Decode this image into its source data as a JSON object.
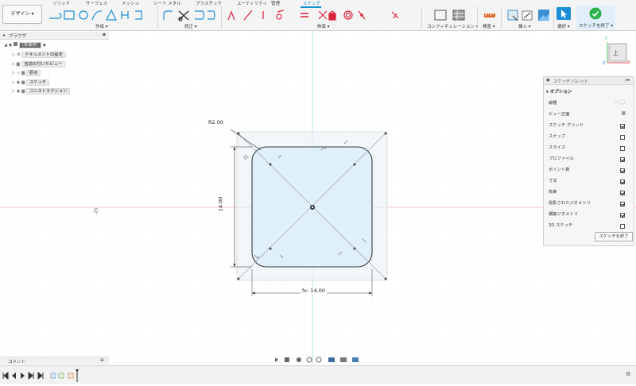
{
  "toolbar": {
    "workspace": "デザイン",
    "tabs": [
      "ソリッド",
      "サーフェス",
      "メッシュ",
      "シート メタル",
      "プラスチック",
      "ユーティリティ",
      "管理",
      "スケッチ"
    ],
    "groups": [
      "作成",
      "修正",
      "拘束",
      "コンフィギュレーション",
      "検査",
      "挿入",
      "選択",
      "スケッチを終了"
    ]
  },
  "browser": {
    "title": "ブラウザ",
    "root": "(未保存)",
    "items": [
      "ドキュメントの設定",
      "名前の付いたビュー",
      "原点",
      "スケッチ",
      "コンストラクション"
    ]
  },
  "comments": {
    "title": "コメント"
  },
  "viewcube": {
    "face": "上",
    "axis_x": "X",
    "axis_y": "Y",
    "axis_z": "Z"
  },
  "palette": {
    "title": "スケッチ パレット",
    "section": "オプション",
    "rows": [
      {
        "label": "線種",
        "checked": null
      },
      {
        "label": "ビュー正面",
        "checked": null
      },
      {
        "label": "スケッチ グリッド",
        "checked": true
      },
      {
        "label": "スナップ",
        "checked": false
      },
      {
        "label": "スライス",
        "checked": false
      },
      {
        "label": "プロファイル",
        "checked": true
      },
      {
        "label": "ポイント数",
        "checked": true
      },
      {
        "label": "寸法",
        "checked": true
      },
      {
        "label": "拘束",
        "checked": true
      },
      {
        "label": "投影されたジオメトリ",
        "checked": true
      },
      {
        "label": "構築ジオメトリ",
        "checked": true
      },
      {
        "label": "3D スケッチ",
        "checked": false
      }
    ],
    "finish_button": "スケッチを終了"
  },
  "sketch": {
    "radius_dim": "R2.00",
    "height_dim": "14.00",
    "width_dim": "fx: 14.00",
    "axis_value": "-25"
  },
  "colors": {
    "accent": "#1a8fd6",
    "finish_green": "#2bb24c",
    "sketch_fill": "#dff0fb",
    "red": "#d9233b"
  }
}
